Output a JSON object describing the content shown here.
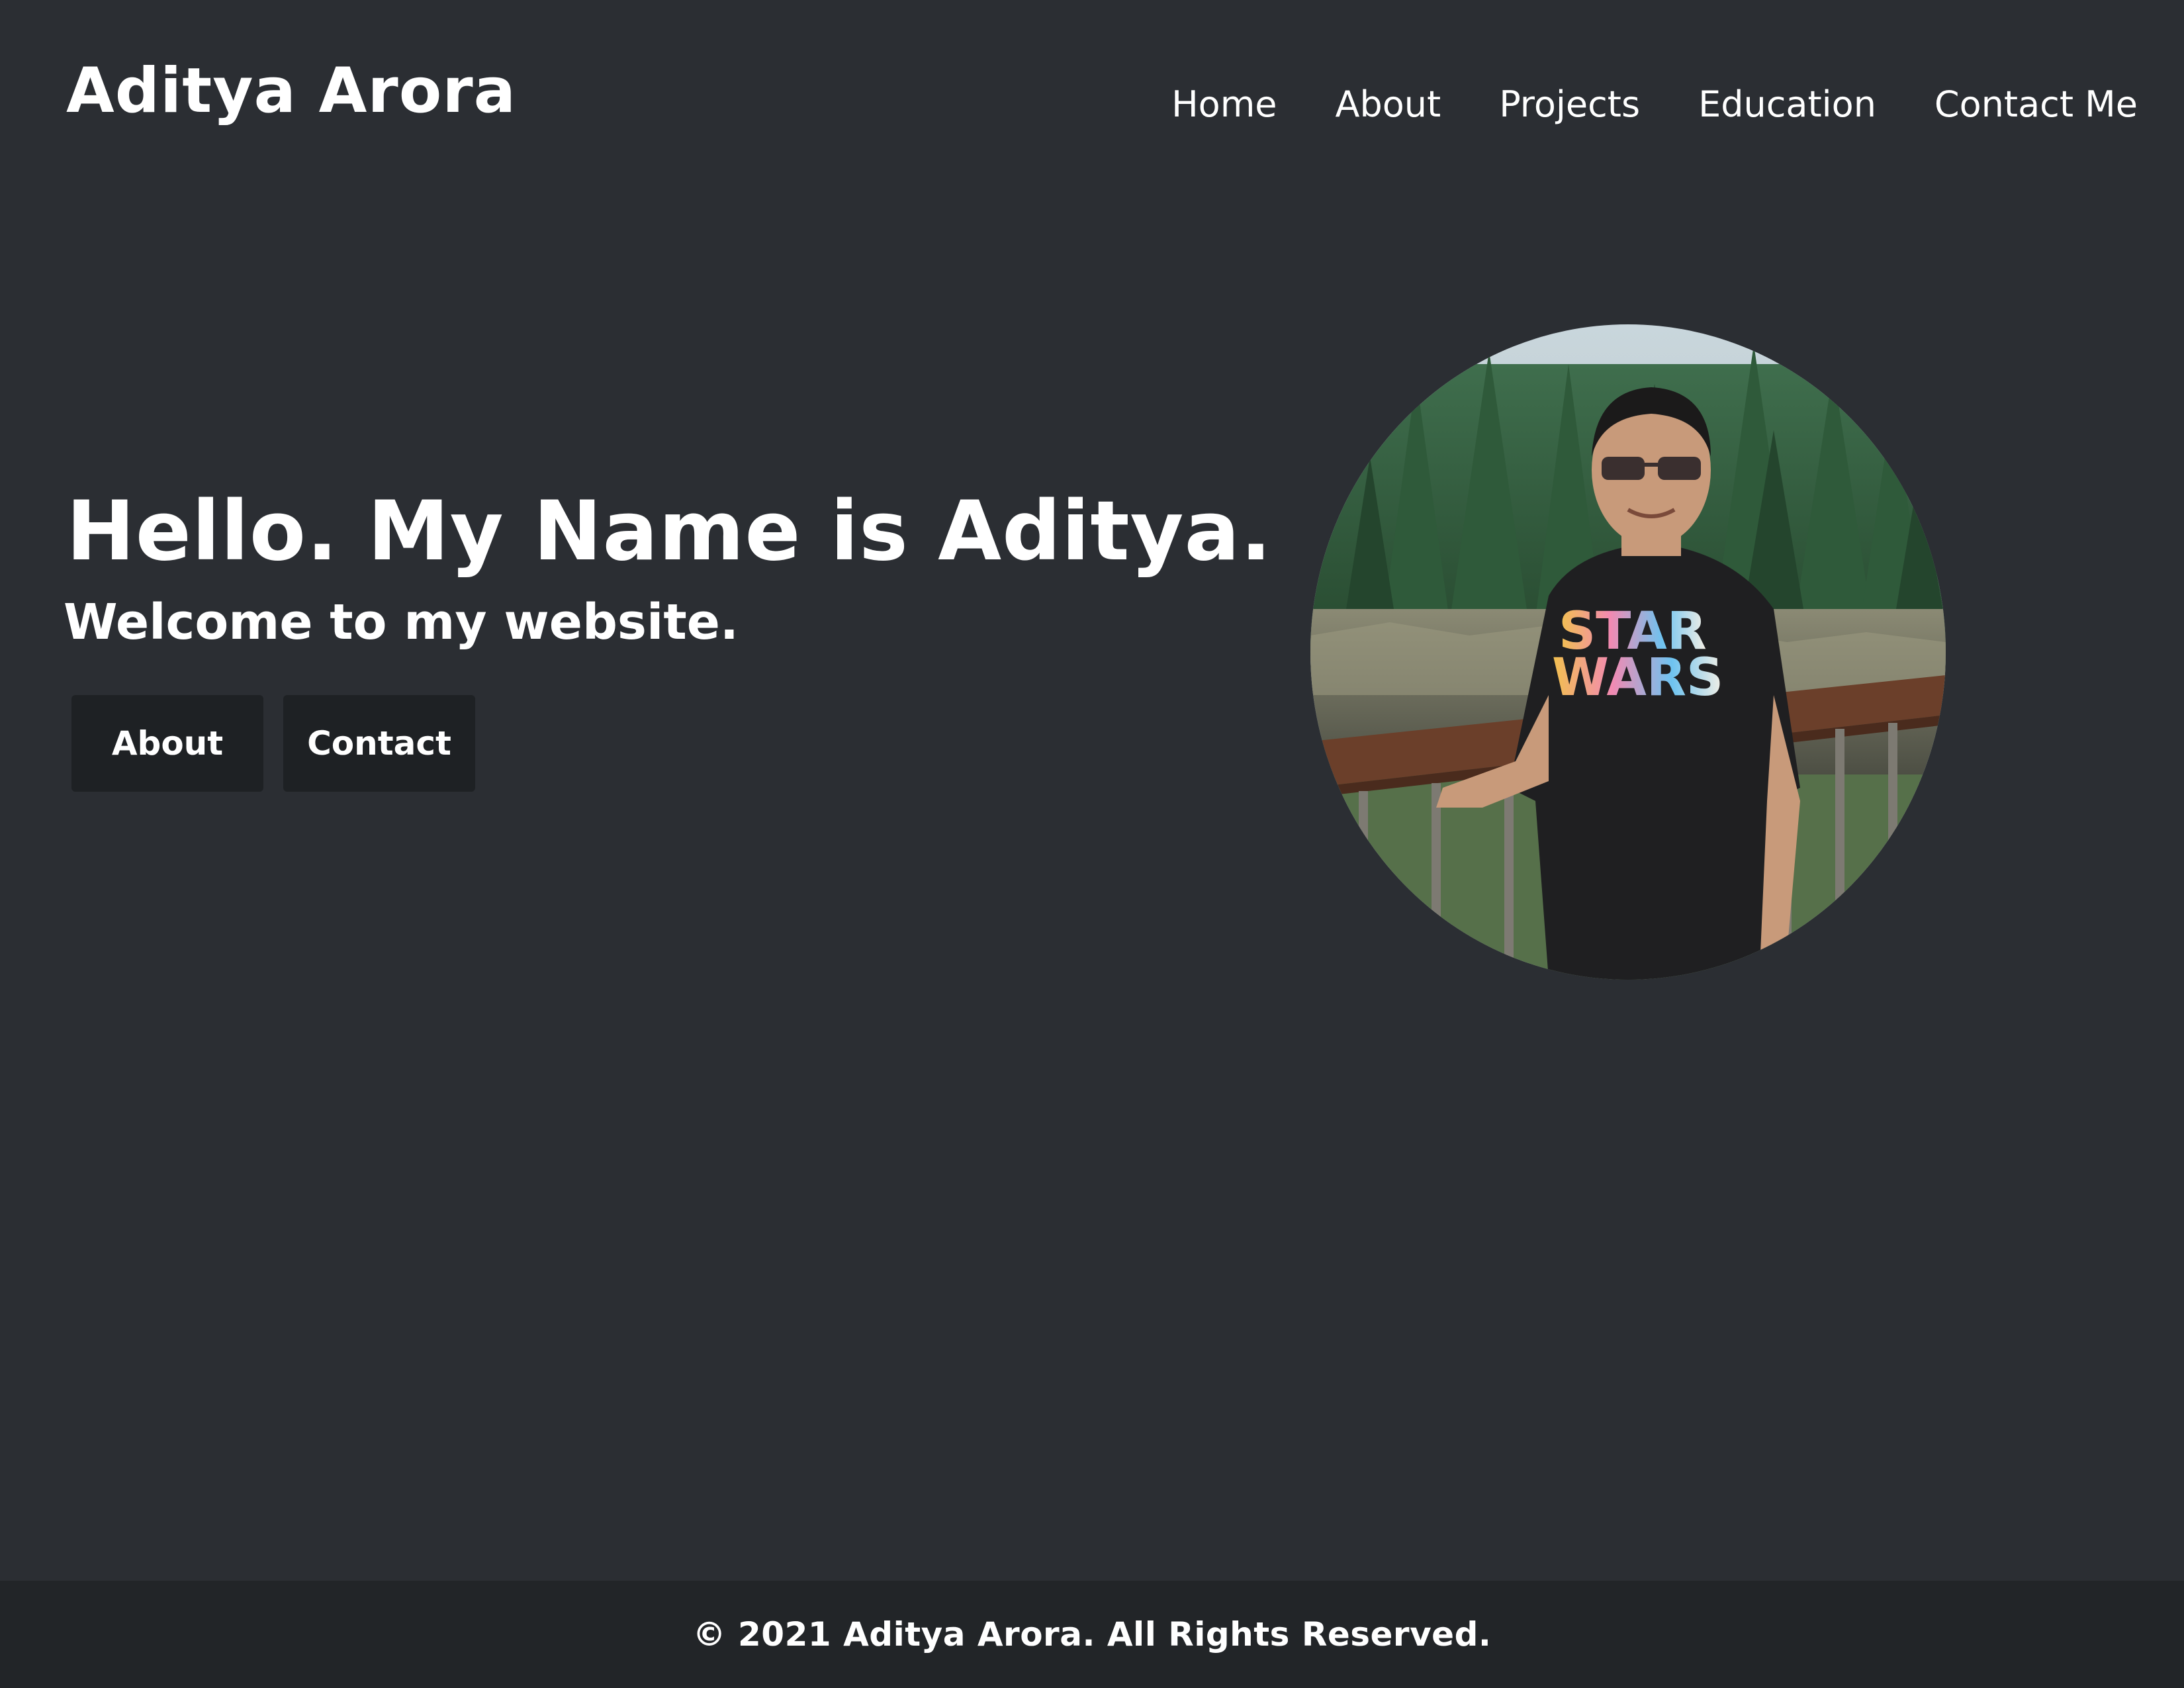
{
  "header": {
    "brand": "Aditya Arora",
    "nav": [
      {
        "label": "Home"
      },
      {
        "label": "About"
      },
      {
        "label": "Projects"
      },
      {
        "label": "Education"
      },
      {
        "label": "Contact Me"
      }
    ]
  },
  "hero": {
    "title": "Hello. My Name is Aditya.",
    "subtitle": "Welcome to my website.",
    "buttons": [
      {
        "label": "About"
      },
      {
        "label": "Contact"
      }
    ],
    "portrait": {
      "shirt_text_line1": "STAR",
      "shirt_text_line2": "WARS"
    }
  },
  "footer": {
    "copyright": "© 2021 Aditya Arora. All Rights Reserved."
  },
  "colors": {
    "background": "#2b2e33",
    "footer_background": "#222528",
    "button_background": "#1e2124",
    "text": "#ffffff"
  }
}
